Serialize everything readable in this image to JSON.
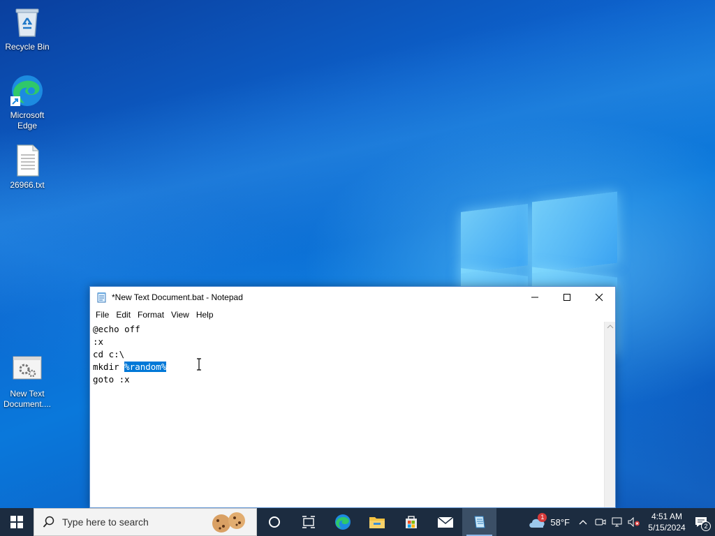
{
  "desktop": {
    "icons": [
      {
        "label": "Recycle Bin"
      },
      {
        "label": "Microsoft Edge"
      },
      {
        "label": "26966.txt"
      },
      {
        "label": "New Text Document...."
      }
    ]
  },
  "notepad": {
    "title": "*New Text Document.bat - Notepad",
    "menu": [
      "File",
      "Edit",
      "Format",
      "View",
      "Help"
    ],
    "lines": [
      "@echo off",
      ":x",
      "cd c:\\",
      "mkdir ",
      "goto :x"
    ],
    "selected_text": "%random%"
  },
  "taskbar": {
    "search_placeholder": "Type here to search",
    "weather": {
      "temp": "58°F",
      "badge": "1"
    },
    "clock": {
      "time": "4:51 AM",
      "date": "5/15/2024"
    },
    "notifications": "2"
  },
  "colors": {
    "selection": "#0078d7",
    "taskbar": "#1c2c40"
  }
}
